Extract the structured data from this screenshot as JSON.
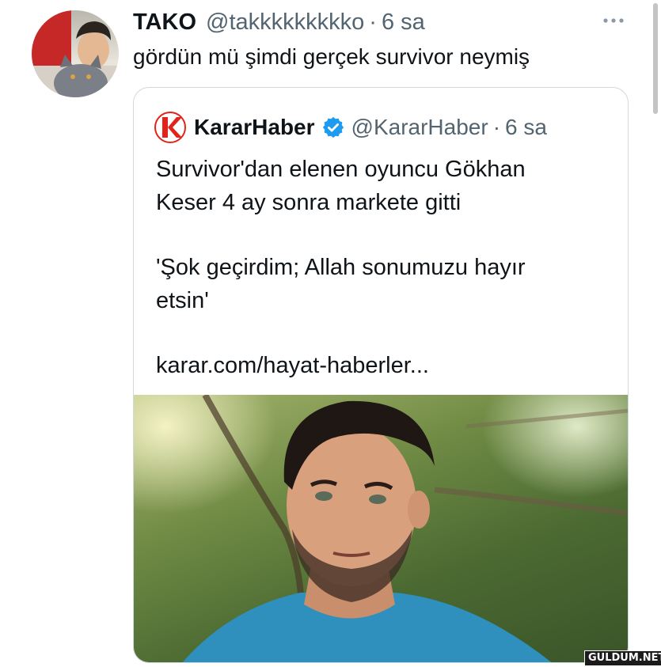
{
  "tweet": {
    "author_name": "TAKO",
    "author_handle": "@takkkkkkkkko",
    "separator": "·",
    "time": "6 sa",
    "text": "gördün mü şimdi gerçek survivor neymiş"
  },
  "quoted_tweet": {
    "author_name": "KararHaber",
    "author_handle": "@KararHaber",
    "separator": "·",
    "time": "6 sa",
    "text_lines": [
      "Survivor'dan elenen oyuncu Gökhan",
      "Keser 4 ay sonra markete gitti",
      "'Şok geçirdim; Allah sonumuzu hayır",
      "etsin'",
      "karar.com/hayat-haberler..."
    ],
    "logo_letter": "K"
  },
  "watermark": "GULDUM.NET",
  "icons": {
    "more": "more-options-icon",
    "verified": "verified-badge-icon",
    "logo": "kararhaber-logo"
  },
  "colors": {
    "text": "#0f1419",
    "secondary": "#536471",
    "border": "#cfd9de",
    "verified": "#1d9bf0",
    "logo_red": "#e2231a"
  }
}
